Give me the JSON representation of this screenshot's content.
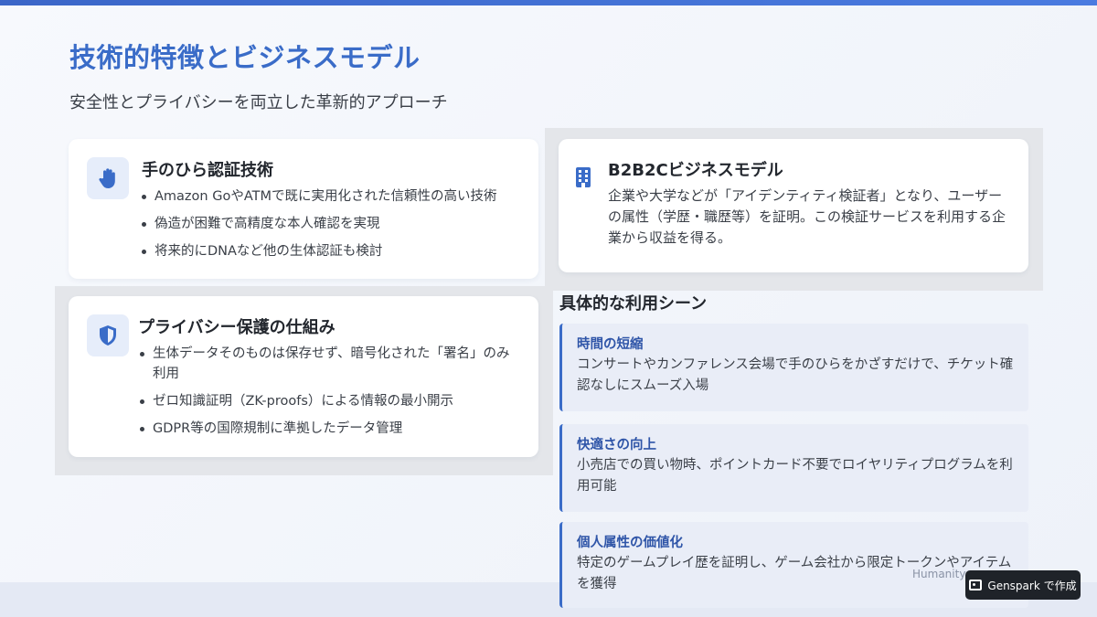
{
  "header": {
    "title": "技術的特徴とビジネスモデル",
    "subtitle": "安全性とプライバシーを両立した革新的アプローチ"
  },
  "cards": {
    "tech": {
      "icon": "hand-icon",
      "title": "手のひら認証技術",
      "bullets": [
        "Amazon GoやATMで既に実用化された信頼性の高い技術",
        "偽造が困難で高精度な本人確認を実現",
        "将来的にDNAなど他の生体認証も検討"
      ]
    },
    "privacy": {
      "icon": "shield-icon",
      "title": "プライバシー保護の仕組み",
      "bullets": [
        "生体データそのものは保存せず、暗号化された「署名」のみ利用",
        "ゼロ知識証明（ZK-proofs）による情報の最小開示",
        "GDPR等の国際規制に準拠したデータ管理"
      ]
    },
    "b2b": {
      "icon": "building-icon",
      "title": "B2B2Cビジネスモデル",
      "description": "企業や大学などが「アイデンティティ検証者」となり、ユーザーの属性（学歴・職歴等）を証明。この検証サービスを利用する企業から収益を得る。"
    }
  },
  "scenes": {
    "heading": "具体的な利用シーン",
    "items": [
      {
        "title": "時間の短縮",
        "text": "コンサートやカンファレンス会場で手のひらをかざすだけで、チケット確認なしにスムーズ入場"
      },
      {
        "title": "快適さの向上",
        "text": "小売店での買い物時、ポイントカード不要でロイヤリティプログラムを利用可能"
      },
      {
        "title": "個人属性の価値化",
        "text": "特定のゲームプレイ歴を証明し、ゲーム会社から限定トークンやアイテムを獲得"
      }
    ]
  },
  "footer": {
    "note": "Humanity",
    "badge_label": "Genspark で作成"
  },
  "colors": {
    "accent": "#3a6cc8",
    "scene_bg": "#e9edf7",
    "badge_bg": "#1f2329"
  }
}
